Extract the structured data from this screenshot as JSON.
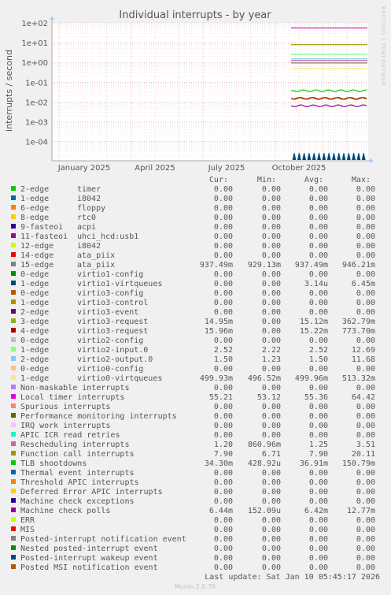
{
  "chart_data": {
    "type": "line",
    "title": "Individual interrupts - by year",
    "ylabel": "interrupts / second",
    "yscale": "log",
    "ylim": [
      2e-05,
      100
    ],
    "y_ticks": [
      "1e+02",
      "1e+01",
      "1e+00",
      "1e-01",
      "1e-02",
      "1e-03",
      "1e-04"
    ],
    "x_ticks": [
      "January 2025",
      "April 2025",
      "July 2025",
      "October 2025"
    ],
    "grid": true,
    "side_label": "RRDTOOL / TOBI OETIKER",
    "columns": [
      "Cur:",
      "Min:",
      "Avg:",
      "Max:"
    ],
    "series": [
      {
        "name": "2-edge",
        "desc": "timer",
        "color": "#00cc00",
        "cur": "0.00",
        "min": "0.00",
        "avg": "0.00",
        "max": "0.00"
      },
      {
        "name": "1-edge",
        "desc": "i8042",
        "color": "#0066b3",
        "cur": "0.00",
        "min": "0.00",
        "avg": "0.00",
        "max": "0.00"
      },
      {
        "name": "6-edge",
        "desc": "floppy",
        "color": "#ff8000",
        "cur": "0.00",
        "min": "0.00",
        "avg": "0.00",
        "max": "0.00"
      },
      {
        "name": "8-edge",
        "desc": "rtc0",
        "color": "#ffcc00",
        "cur": "0.00",
        "min": "0.00",
        "avg": "0.00",
        "max": "0.00"
      },
      {
        "name": "9-fasteoi",
        "desc": "acpi",
        "color": "#330099",
        "cur": "0.00",
        "min": "0.00",
        "avg": "0.00",
        "max": "0.00"
      },
      {
        "name": "11-fasteoi",
        "desc": "uhci_hcd:usb1",
        "color": "#990099",
        "cur": "0.00",
        "min": "0.00",
        "avg": "0.00",
        "max": "0.00"
      },
      {
        "name": "12-edge",
        "desc": "i8042",
        "color": "#ccff00",
        "cur": "0.00",
        "min": "0.00",
        "avg": "0.00",
        "max": "0.00"
      },
      {
        "name": "14-edge",
        "desc": "ata_piix",
        "color": "#ff0000",
        "cur": "0.00",
        "min": "0.00",
        "avg": "0.00",
        "max": "0.00"
      },
      {
        "name": "15-edge",
        "desc": "ata_piix",
        "color": "#808080",
        "cur": "937.49m",
        "min": "929.13m",
        "avg": "937.49m",
        "max": "946.21m"
      },
      {
        "name": "0-edge",
        "desc": "virtio1-config",
        "color": "#008f00",
        "cur": "0.00",
        "min": "0.00",
        "avg": "0.00",
        "max": "0.00"
      },
      {
        "name": "1-edge",
        "desc": "virtio1-virtqueues",
        "color": "#00487d",
        "cur": "0.00",
        "min": "0.00",
        "avg": "3.14u",
        "max": "6.45m"
      },
      {
        "name": "0-edge",
        "desc": "virtio3-config",
        "color": "#b35a00",
        "cur": "0.00",
        "min": "0.00",
        "avg": "0.00",
        "max": "0.00"
      },
      {
        "name": "1-edge",
        "desc": "virtio3-control",
        "color": "#b38f00",
        "cur": "0.00",
        "min": "0.00",
        "avg": "0.00",
        "max": "0.00"
      },
      {
        "name": "2-edge",
        "desc": "virtio3-event",
        "color": "#6b006b",
        "cur": "0.00",
        "min": "0.00",
        "avg": "0.00",
        "max": "0.00"
      },
      {
        "name": "3-edge",
        "desc": "virtio3-request",
        "color": "#8fb300",
        "cur": "14.95m",
        "min": "0.00",
        "avg": "15.12m",
        "max": "362.79m"
      },
      {
        "name": "4-edge",
        "desc": "virtio3-request",
        "color": "#b30000",
        "cur": "15.96m",
        "min": "0.00",
        "avg": "15.22m",
        "max": "773.70m"
      },
      {
        "name": "0-edge",
        "desc": "virtio2-config",
        "color": "#bebebe",
        "cur": "0.00",
        "min": "0.00",
        "avg": "0.00",
        "max": "0.00"
      },
      {
        "name": "1-edge",
        "desc": "virtio2-input.0",
        "color": "#80ff80",
        "cur": "2.52",
        "min": "2.22",
        "avg": "2.52",
        "max": "12.69"
      },
      {
        "name": "2-edge",
        "desc": "virtio2-output.0",
        "color": "#80c9ff",
        "cur": "1.50",
        "min": "1.23",
        "avg": "1.50",
        "max": "11.68"
      },
      {
        "name": "0-edge",
        "desc": "virtio0-config",
        "color": "#ffc080",
        "cur": "0.00",
        "min": "0.00",
        "avg": "0.00",
        "max": "0.00"
      },
      {
        "name": "1-edge",
        "desc": "virtio0-virtqueues",
        "color": "#ffe680",
        "cur": "499.93m",
        "min": "496.52m",
        "avg": "499.96m",
        "max": "513.32m"
      },
      {
        "name": "Non-maskable interrupts",
        "desc": "",
        "color": "#aa80ff",
        "cur": "0.00",
        "min": "0.00",
        "avg": "0.00",
        "max": "0.00"
      },
      {
        "name": "Local timer interrupts",
        "desc": "",
        "color": "#ee00cc",
        "cur": "55.21",
        "min": "53.12",
        "avg": "55.36",
        "max": "64.42"
      },
      {
        "name": "Spurious interrupts",
        "desc": "",
        "color": "#ff8080",
        "cur": "0.00",
        "min": "0.00",
        "avg": "0.00",
        "max": "0.00"
      },
      {
        "name": "Performance monitoring interrupts",
        "desc": "",
        "color": "#666600",
        "cur": "0.00",
        "min": "0.00",
        "avg": "0.00",
        "max": "0.00"
      },
      {
        "name": "IRQ work interrupts",
        "desc": "",
        "color": "#ffbfff",
        "cur": "0.00",
        "min": "0.00",
        "avg": "0.00",
        "max": "0.00"
      },
      {
        "name": "APIC ICR read retries",
        "desc": "",
        "color": "#00ffcc",
        "cur": "0.00",
        "min": "0.00",
        "avg": "0.00",
        "max": "0.00"
      },
      {
        "name": "Rescheduling interrupts",
        "desc": "",
        "color": "#cc6699",
        "cur": "1.20",
        "min": "860.96m",
        "avg": "1.25",
        "max": "3.51"
      },
      {
        "name": "Function call interrupts",
        "desc": "",
        "color": "#999900",
        "cur": "7.90",
        "min": "6.71",
        "avg": "7.90",
        "max": "20.11"
      },
      {
        "name": "TLB shootdowns",
        "desc": "",
        "color": "#00cc00",
        "cur": "34.30m",
        "min": "428.92u",
        "avg": "36.91m",
        "max": "150.79m"
      },
      {
        "name": "Thermal event interrupts",
        "desc": "",
        "color": "#0066b3",
        "cur": "0.00",
        "min": "0.00",
        "avg": "0.00",
        "max": "0.00"
      },
      {
        "name": "Threshold APIC interrupts",
        "desc": "",
        "color": "#ff8000",
        "cur": "0.00",
        "min": "0.00",
        "avg": "0.00",
        "max": "0.00"
      },
      {
        "name": "Deferred Error APIC interrupts",
        "desc": "",
        "color": "#ffcc00",
        "cur": "0.00",
        "min": "0.00",
        "avg": "0.00",
        "max": "0.00"
      },
      {
        "name": "Machine check exceptions",
        "desc": "",
        "color": "#330099",
        "cur": "0.00",
        "min": "0.00",
        "avg": "0.00",
        "max": "0.00"
      },
      {
        "name": "Machine check polls",
        "desc": "",
        "color": "#990099",
        "cur": "6.44m",
        "min": "152.09u",
        "avg": "6.42m",
        "max": "12.77m"
      },
      {
        "name": "ERR",
        "desc": "",
        "color": "#ccff00",
        "cur": "0.00",
        "min": "0.00",
        "avg": "0.00",
        "max": "0.00"
      },
      {
        "name": "MIS",
        "desc": "",
        "color": "#ff0000",
        "cur": "0.00",
        "min": "0.00",
        "avg": "0.00",
        "max": "0.00"
      },
      {
        "name": "Posted-interrupt notification event",
        "desc": "",
        "color": "#808080",
        "cur": "0.00",
        "min": "0.00",
        "avg": "0.00",
        "max": "0.00"
      },
      {
        "name": "Nested posted-interrupt event",
        "desc": "",
        "color": "#008f00",
        "cur": "0.00",
        "min": "0.00",
        "avg": "0.00",
        "max": "0.00"
      },
      {
        "name": "Posted-interrupt wakeup event",
        "desc": "",
        "color": "#00487d",
        "cur": "0.00",
        "min": "0.00",
        "avg": "0.00",
        "max": "0.00"
      },
      {
        "name": "Posted MSI notification event",
        "desc": "",
        "color": "#b35a00",
        "cur": "0.00",
        "min": "0.00",
        "avg": "0.00",
        "max": "0.00"
      }
    ],
    "last_update": "Last update: Sat Jan 10 05:45:17 2026",
    "footer": "Munin 2.0.76"
  }
}
